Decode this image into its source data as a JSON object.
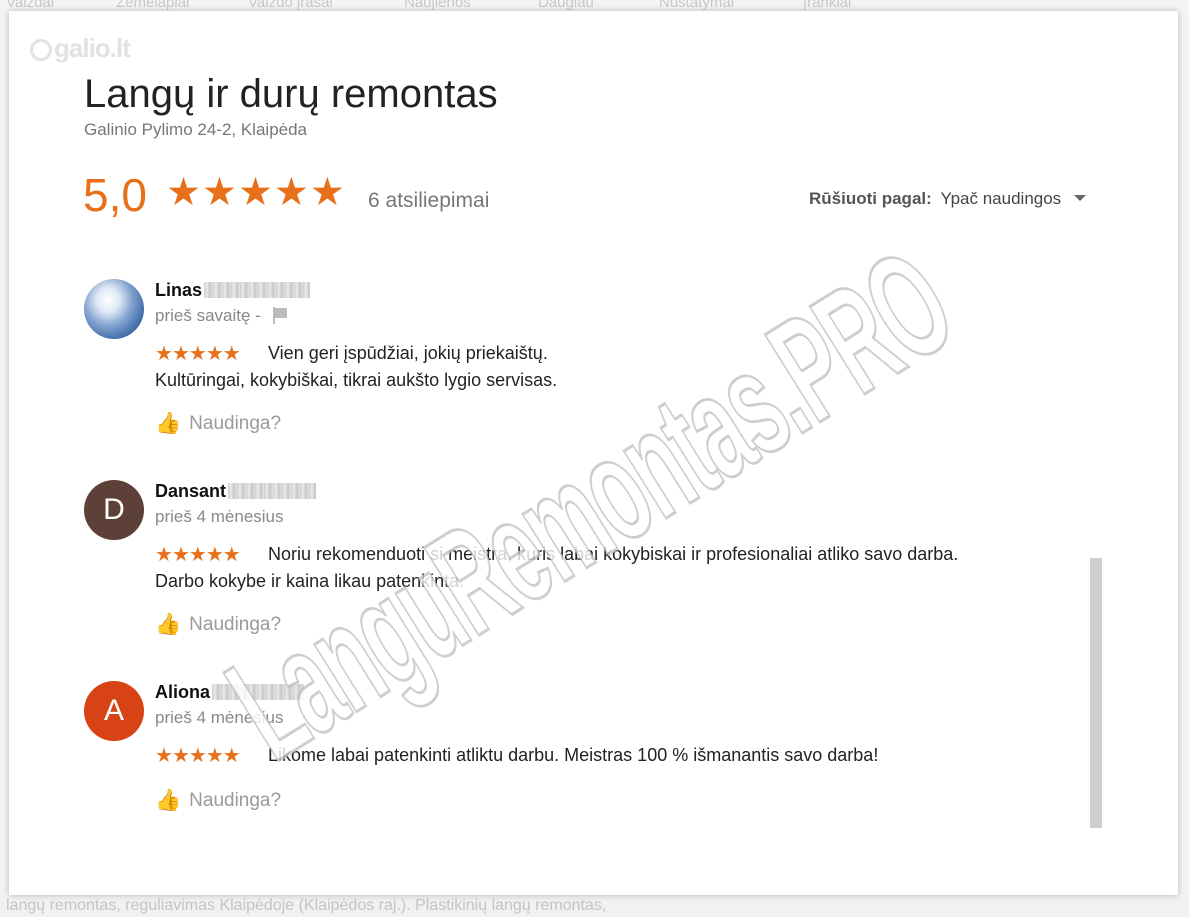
{
  "background": {
    "nav_items": [
      "Vaizdai",
      "Žemėlapiai",
      "Vaizdo įrašai",
      "Naujienos",
      "Daugiau",
      "Nustatymai",
      "Įrankiai"
    ],
    "footer_text": "langų remontas, reguliavimas Klaipėdoje (Klaipėdos raj.). Plastikinių langų remontas,"
  },
  "dialog": {
    "logo": "galio.lt",
    "title": "Langų ir durų remontas",
    "address": "Galinio Pylimo 24-2, Klaipėda",
    "rating_value": "5,0",
    "rating_stars": 5,
    "review_count": "6 atsiliepimai",
    "sort_label": "Rūšiuoti pagal:",
    "sort_value": "Ypač naudingos"
  },
  "reviews": [
    {
      "name": "Linas",
      "avatar_letter": "",
      "avatar_color": "#3e6aa7",
      "time": "prieš savaitę -",
      "stars": 5,
      "line1": "Vien geri įspūdžiai, jokių priekaištų.",
      "line2": "Kultūringai, kokybiškai, tikrai aukšto lygio servisas.",
      "helpful": "Naudinga?"
    },
    {
      "name": "Dansant",
      "avatar_letter": "D",
      "avatar_color": "#5d4037",
      "time": "prieš 4 mėnesius",
      "stars": 5,
      "line1": "Noriu rekomenduoti si meistra, kuris labai kokybiskai ir profesionaliai atliko savo darba.",
      "line2": "Darbo kokybe ir kaina likau patenkinta.",
      "helpful": "Naudinga?"
    },
    {
      "name": "Aliona",
      "avatar_letter": "A",
      "avatar_color": "#d84315",
      "time": "prieš 4 mėnesius",
      "stars": 5,
      "line1": "Likome labai patenkinti atliktu darbu. Meistras 100 % išmanantis savo darba!",
      "line2": "",
      "helpful": "Naudinga?"
    }
  ],
  "icons": {
    "star": "★",
    "thumb": "👍"
  },
  "colors": {
    "accent": "#e7711b"
  },
  "watermark": "LanguRemontas.PRO"
}
